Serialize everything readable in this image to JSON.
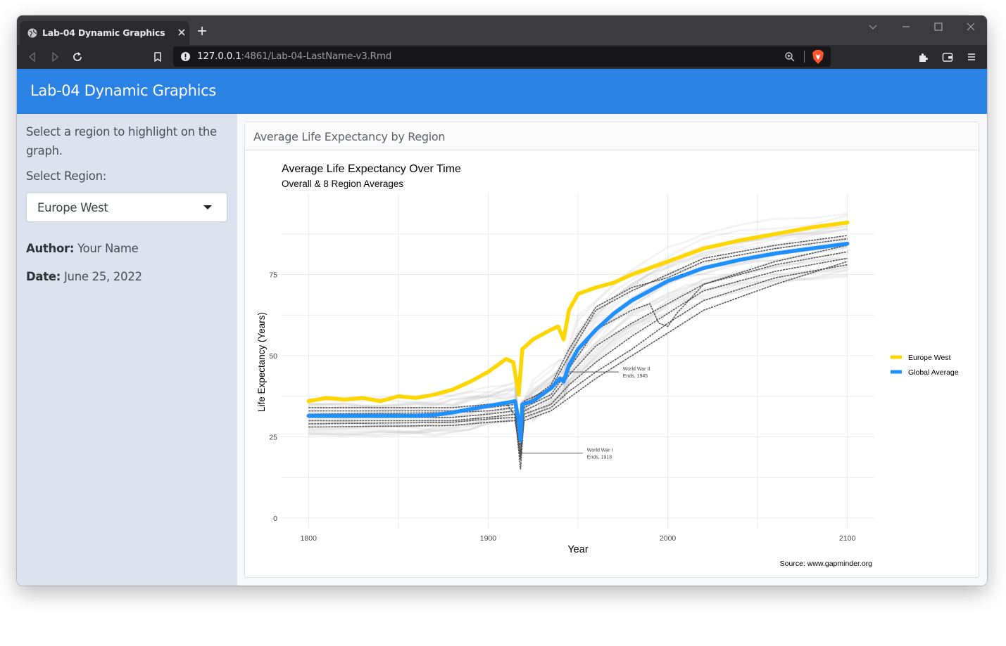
{
  "browser": {
    "tab_title": "Lab-04 Dynamic Graphics",
    "url_host": "127.0.0.1",
    "url_rest": ":4861/Lab-04-LastName-v3.Rmd"
  },
  "app": {
    "title": "Lab-04 Dynamic Graphics"
  },
  "sidebar": {
    "intro": "Select a region to highlight on the graph.",
    "select_label": "Select Region:",
    "select_value": "Europe West",
    "author_label": "Author:",
    "author_value": "Your Name",
    "date_label": "Date:",
    "date_value": "June 25, 2022"
  },
  "panel": {
    "title": "Average Life Expectancy by Region"
  },
  "colors": {
    "highlight": "#ffd700",
    "global": "#1e90ff",
    "accent": "#2a82e4"
  },
  "chart_data": {
    "type": "line",
    "title": "Average Life Expectancy Over Time",
    "subtitle": "Overall & 8 Region Averages",
    "xlabel": "Year",
    "ylabel": "Life Expectancy (Years)",
    "caption": "Source: www.gapminder.org",
    "xlim": [
      1785,
      2115
    ],
    "ylim": [
      0,
      100
    ],
    "x_ticks": [
      1800,
      1900,
      2000,
      2100
    ],
    "y_ticks": [
      0,
      25,
      50,
      75
    ],
    "grid": true,
    "legend_position": "right",
    "series": [
      {
        "name": "Europe West",
        "color": "#ffd700",
        "points": [
          [
            1800,
            36
          ],
          [
            1810,
            37
          ],
          [
            1820,
            36.5
          ],
          [
            1830,
            37
          ],
          [
            1840,
            36
          ],
          [
            1850,
            37.5
          ],
          [
            1860,
            37
          ],
          [
            1870,
            38
          ],
          [
            1880,
            39.5
          ],
          [
            1890,
            42
          ],
          [
            1900,
            45
          ],
          [
            1910,
            49
          ],
          [
            1914,
            48
          ],
          [
            1917,
            38
          ],
          [
            1919,
            52
          ],
          [
            1925,
            55
          ],
          [
            1935,
            58
          ],
          [
            1939,
            59
          ],
          [
            1942,
            55
          ],
          [
            1945,
            64
          ],
          [
            1950,
            69
          ],
          [
            1960,
            71
          ],
          [
            1970,
            72.5
          ],
          [
            1980,
            75
          ],
          [
            1990,
            77
          ],
          [
            2000,
            79
          ],
          [
            2010,
            81
          ],
          [
            2020,
            83
          ],
          [
            2040,
            85.5
          ],
          [
            2060,
            87.5
          ],
          [
            2080,
            89.5
          ],
          [
            2100,
            91
          ]
        ]
      },
      {
        "name": "Global Average",
        "color": "#1e90ff",
        "points": [
          [
            1800,
            31.5
          ],
          [
            1820,
            31.5
          ],
          [
            1840,
            31.5
          ],
          [
            1860,
            31.5
          ],
          [
            1870,
            31.7
          ],
          [
            1880,
            32.5
          ],
          [
            1890,
            33.5
          ],
          [
            1900,
            34.5
          ],
          [
            1910,
            35.5
          ],
          [
            1915,
            36
          ],
          [
            1917,
            30
          ],
          [
            1918,
            24
          ],
          [
            1919,
            35
          ],
          [
            1925,
            36
          ],
          [
            1935,
            40
          ],
          [
            1940,
            43
          ],
          [
            1942,
            42
          ],
          [
            1945,
            47
          ],
          [
            1950,
            52
          ],
          [
            1960,
            58
          ],
          [
            1970,
            63
          ],
          [
            1980,
            67
          ],
          [
            1990,
            70
          ],
          [
            2000,
            73
          ],
          [
            2010,
            75
          ],
          [
            2020,
            77
          ],
          [
            2040,
            79.5
          ],
          [
            2060,
            81.5
          ],
          [
            2080,
            83
          ],
          [
            2100,
            84.5
          ]
        ]
      }
    ],
    "region_lines": [
      {
        "points": [
          [
            1800,
            34
          ],
          [
            1880,
            34
          ],
          [
            1900,
            35
          ],
          [
            1910,
            35.5
          ],
          [
            1917,
            30
          ],
          [
            1920,
            36
          ],
          [
            1935,
            40
          ],
          [
            1945,
            50
          ],
          [
            1960,
            64
          ],
          [
            1980,
            70
          ],
          [
            2000,
            75
          ],
          [
            2020,
            80
          ],
          [
            2060,
            84
          ],
          [
            2100,
            87
          ]
        ]
      },
      {
        "points": [
          [
            1800,
            33
          ],
          [
            1880,
            33
          ],
          [
            1900,
            34
          ],
          [
            1915,
            35
          ],
          [
            1918,
            28
          ],
          [
            1920,
            35
          ],
          [
            1935,
            41
          ],
          [
            1945,
            52
          ],
          [
            1960,
            65
          ],
          [
            1980,
            71
          ],
          [
            2000,
            74
          ],
          [
            2020,
            79
          ],
          [
            2060,
            83
          ],
          [
            2100,
            86
          ]
        ]
      },
      {
        "points": [
          [
            1800,
            32
          ],
          [
            1880,
            32.5
          ],
          [
            1900,
            33
          ],
          [
            1915,
            34
          ],
          [
            1918,
            22
          ],
          [
            1920,
            34
          ],
          [
            1935,
            38
          ],
          [
            1945,
            46
          ],
          [
            1960,
            58
          ],
          [
            1980,
            64
          ],
          [
            1990,
            66
          ],
          [
            1995,
            60
          ],
          [
            2000,
            59
          ],
          [
            2005,
            63
          ],
          [
            2020,
            72
          ],
          [
            2060,
            79
          ],
          [
            2100,
            84
          ]
        ]
      },
      {
        "points": [
          [
            1800,
            31
          ],
          [
            1880,
            31
          ],
          [
            1900,
            32
          ],
          [
            1915,
            33
          ],
          [
            1918,
            20
          ],
          [
            1920,
            33
          ],
          [
            1935,
            37
          ],
          [
            1945,
            44
          ],
          [
            1960,
            53
          ],
          [
            1980,
            60
          ],
          [
            2000,
            66
          ],
          [
            2020,
            72
          ],
          [
            2060,
            78
          ],
          [
            2100,
            82
          ]
        ]
      },
      {
        "points": [
          [
            1800,
            30
          ],
          [
            1880,
            30
          ],
          [
            1900,
            31
          ],
          [
            1915,
            32
          ],
          [
            1918,
            15
          ],
          [
            1920,
            32
          ],
          [
            1935,
            35
          ],
          [
            1945,
            41
          ],
          [
            1960,
            48
          ],
          [
            1980,
            56
          ],
          [
            2000,
            63
          ],
          [
            2020,
            70
          ],
          [
            2060,
            76
          ],
          [
            2100,
            80
          ]
        ]
      },
      {
        "points": [
          [
            1800,
            29
          ],
          [
            1880,
            29.5
          ],
          [
            1900,
            30.5
          ],
          [
            1915,
            31
          ],
          [
            1918,
            18
          ],
          [
            1920,
            31
          ],
          [
            1935,
            34
          ],
          [
            1945,
            39
          ],
          [
            1960,
            45
          ],
          [
            1980,
            52
          ],
          [
            2000,
            60
          ],
          [
            2020,
            67
          ],
          [
            2060,
            74
          ],
          [
            2100,
            78
          ]
        ]
      },
      {
        "points": [
          [
            1800,
            28
          ],
          [
            1880,
            28.5
          ],
          [
            1900,
            29.5
          ],
          [
            1915,
            30
          ],
          [
            1918,
            19
          ],
          [
            1920,
            30
          ],
          [
            1935,
            33
          ],
          [
            1945,
            37
          ],
          [
            1960,
            43
          ],
          [
            1980,
            50
          ],
          [
            2000,
            57
          ],
          [
            2020,
            64
          ],
          [
            2060,
            72
          ],
          [
            2100,
            79
          ]
        ]
      }
    ],
    "annotations": [
      {
        "label": [
          "World War II",
          "Ends, 1945"
        ],
        "x": 1945,
        "y": 45,
        "text_x": 1975
      },
      {
        "label": [
          "World War I",
          "Ends, 1918"
        ],
        "x": 1918,
        "y": 20,
        "text_x": 1955
      }
    ]
  }
}
